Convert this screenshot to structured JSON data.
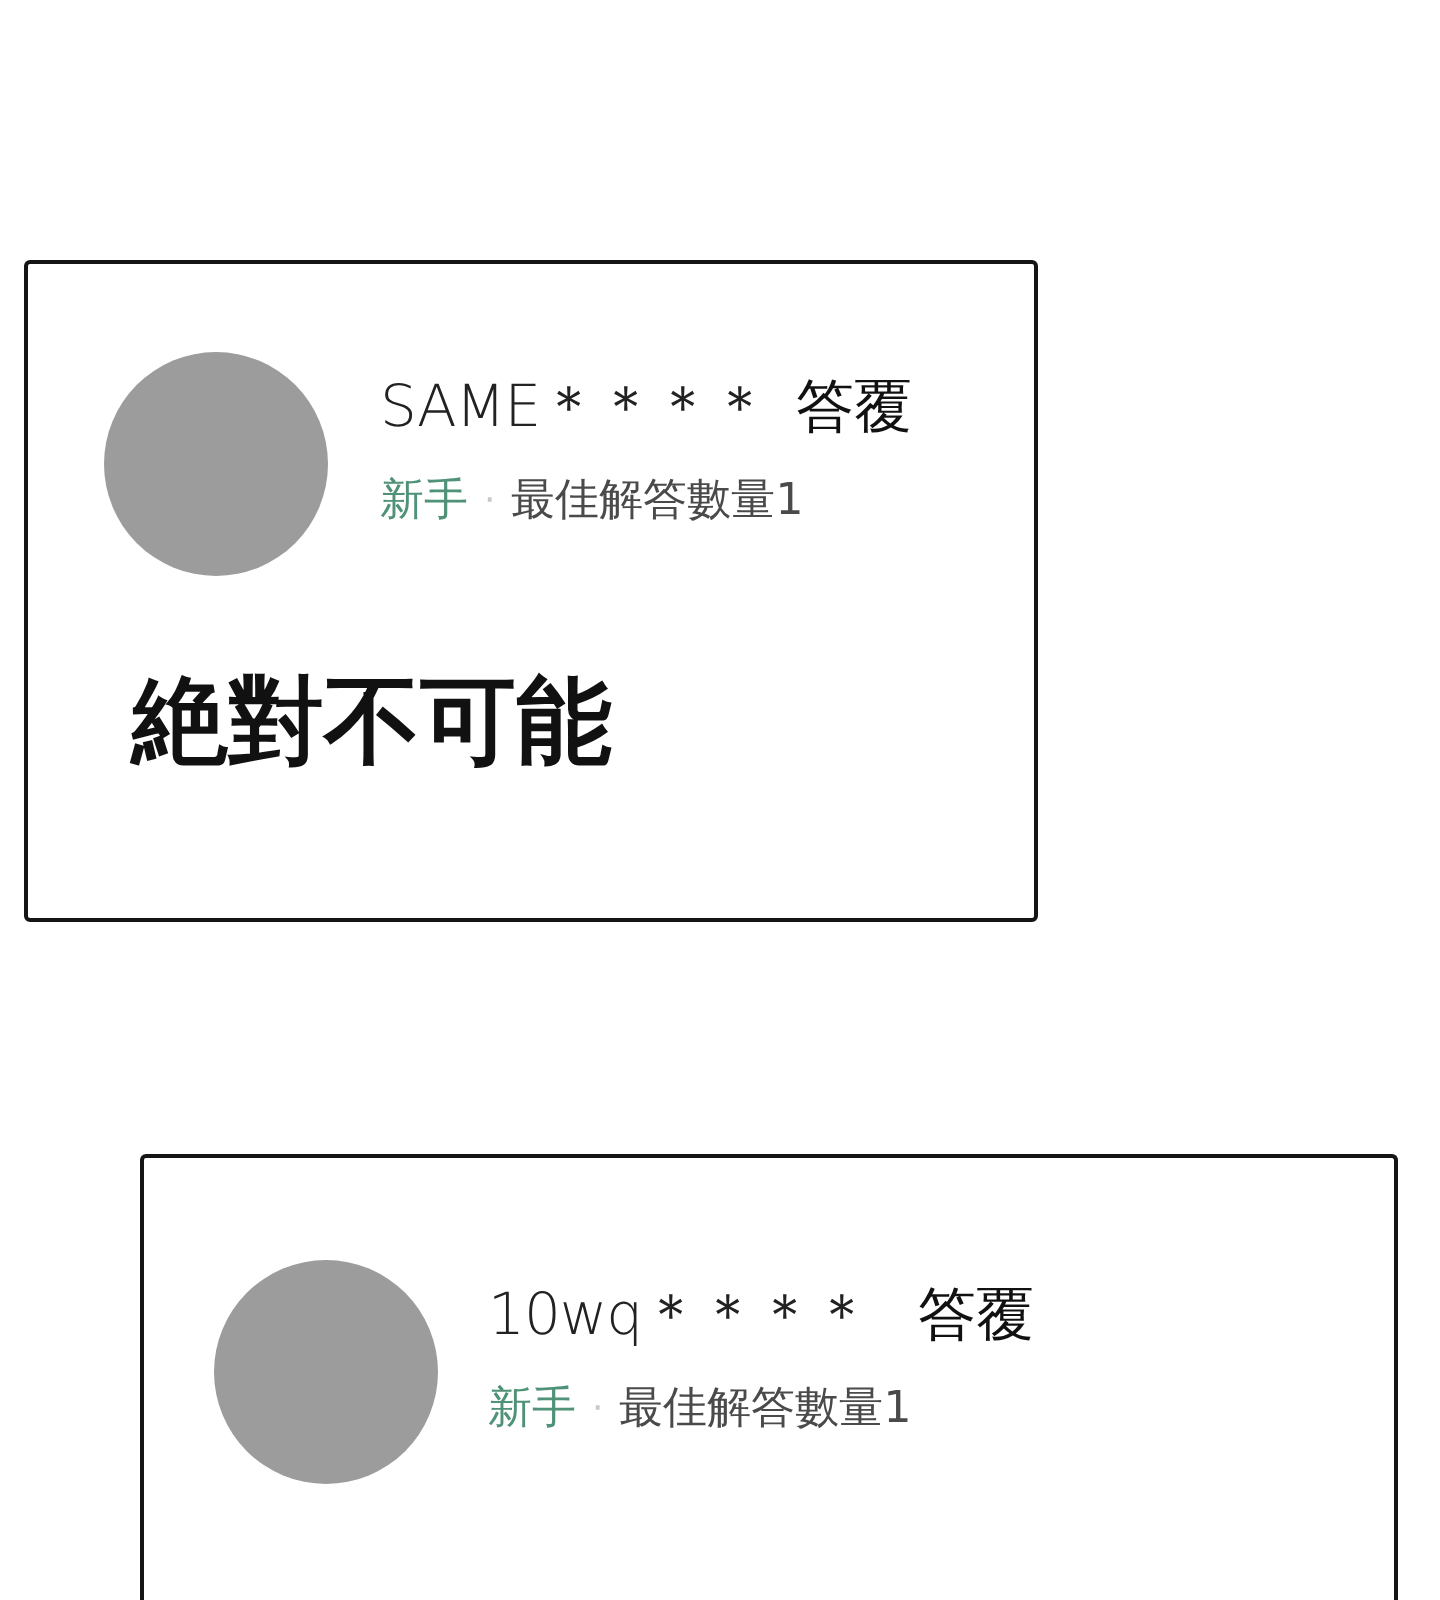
{
  "answers": [
    {
      "user": "SAME＊＊＊＊",
      "action": "答覆",
      "rank": "新手",
      "separator": "·",
      "best_answers": "最佳解答數量1",
      "body": "絶對不可能"
    },
    {
      "user": "10wq＊＊＊＊",
      "action": "答覆",
      "rank": "新手",
      "separator": "·",
      "best_answers": "最佳解答數量1"
    }
  ]
}
